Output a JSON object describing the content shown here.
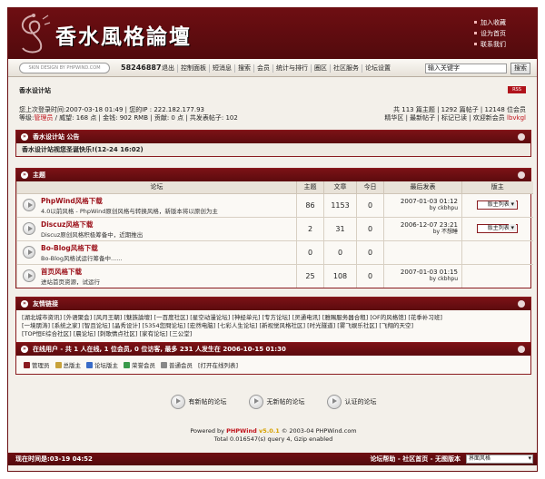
{
  "header": {
    "site_title": "香水風格論壇",
    "top_links": [
      "加入收藏",
      "设为首页",
      "联系我们"
    ]
  },
  "menubar": {
    "skin_button": "SKIN DESIGN BY PHPWIND.COM",
    "online_id": "58246887",
    "items": [
      "退出",
      "控制面板",
      "短消息",
      "搜索",
      "会员",
      "统计与排行",
      "圈区",
      "社区服务",
      "论坛设置"
    ],
    "search_value": "输入关键字",
    "search_button": "搜索"
  },
  "breadcrumb": {
    "label": "香水设计站",
    "rss": "RSS"
  },
  "userinfo": {
    "line1": "您上次登录时间:2007-03-18 01:49 | 您的IP : 222.182.177.93",
    "line2_pre": "等级:",
    "line2_rank": "管理员",
    "line2_post": " / 威望: 168 点 | 金钱: 902 RMB | 贡献: 0 点 | 共发表帖子: 102",
    "stats_line": "共 113 篇主题 | 1292 篇帖子 | 12148 位会员",
    "links_line": "精华区 | 最新帖子 | 标记已读 | 欢迎新会员",
    "new_member": "lbvkgl"
  },
  "notice": {
    "header": "香水设计站 公告",
    "text": "香水设计站视您圣诞快乐!(12-24 16:02)"
  },
  "forum": {
    "header": "主题",
    "columns": [
      "论坛",
      "主题",
      "文章",
      "今日",
      "最后发表",
      "版主"
    ],
    "rows": [
      {
        "name": "PhpWind风格下载",
        "desc": "4.0以前风格 - PhpWind原创风格与转换风格，新版本将以原创为主",
        "topics": "86",
        "posts": "1153",
        "today": "0",
        "last_date": "2007-01-03 01:12",
        "last_by": "by ckbhpu",
        "mod": "版主列表"
      },
      {
        "name": "Discuz风格下载",
        "desc": "Discuz原创风格积极筹备中，近期推出",
        "topics": "2",
        "posts": "31",
        "today": "0",
        "last_date": "2006-12-07 23:21",
        "last_by": "by 不想睡",
        "mod": "版主列表"
      },
      {
        "name": "Bo-Blog风格下载",
        "desc": "Bo-Blog风格试运行筹备中......",
        "topics": "0",
        "posts": "0",
        "today": "0",
        "last_date": "",
        "last_by": "",
        "mod": ""
      },
      {
        "name": "首页风格下载",
        "desc": "进站首页资源，试运行",
        "topics": "25",
        "posts": "108",
        "today": "0",
        "last_date": "2007-01-03 01:15",
        "last_by": "by ckbhpu",
        "mod": ""
      }
    ]
  },
  "links": {
    "header": "友情链接",
    "line1": "[湖北城市资讯] [外语聚会] [风月王朝] [魅族論壇] [一百度社区] [星空动漫论坛] [神经单元] [专方论坛] [灵通电讯] [雅赐服务器合租] [OF的风格馆] [花季补习班]",
    "line2": "[一境朋涛] [系统之家] [智且论坛] [晶秀设计] [5354您問论坛] [宏然电脑] [七彩人生论坛] [新视觉风格社区] [时光隧道] [雾飞娱乐社区] [飞翔的天空]",
    "line3": "[TOP恒E综合社区] [晨论坛] [刺歌情点社区] [家有论坛] [三公堂]"
  },
  "online": {
    "header": "在线用户 - 共 1 人在线, 1 位会员, 0 位访客, 最多 231 人发生在 2006-10-15 01:30",
    "legend": [
      "管理员",
      "总版主",
      "论坛版主",
      "荣誉会员",
      "普通会员",
      "[打开在线列表]"
    ]
  },
  "legend_bottom": [
    "有新帖的论坛",
    "无新帖的论坛",
    "认证的论坛"
  ],
  "footer": {
    "powered_pre": "Powered by ",
    "powered_brand": "PHPWind",
    "powered_ver": " v5.0.1",
    "powered_post": " © 2003-04 PHPWind.com",
    "total": "Total 0.016547(s) query 4,  Gzip enabled"
  },
  "statusbar": {
    "time": "现在时间是:03-19 04:52",
    "links": "论坛帮助 - 社区首页 - 无图版本",
    "style": "界面风格"
  },
  "colors": {
    "brand": "#6e0e12",
    "accent": "#c0121b"
  }
}
